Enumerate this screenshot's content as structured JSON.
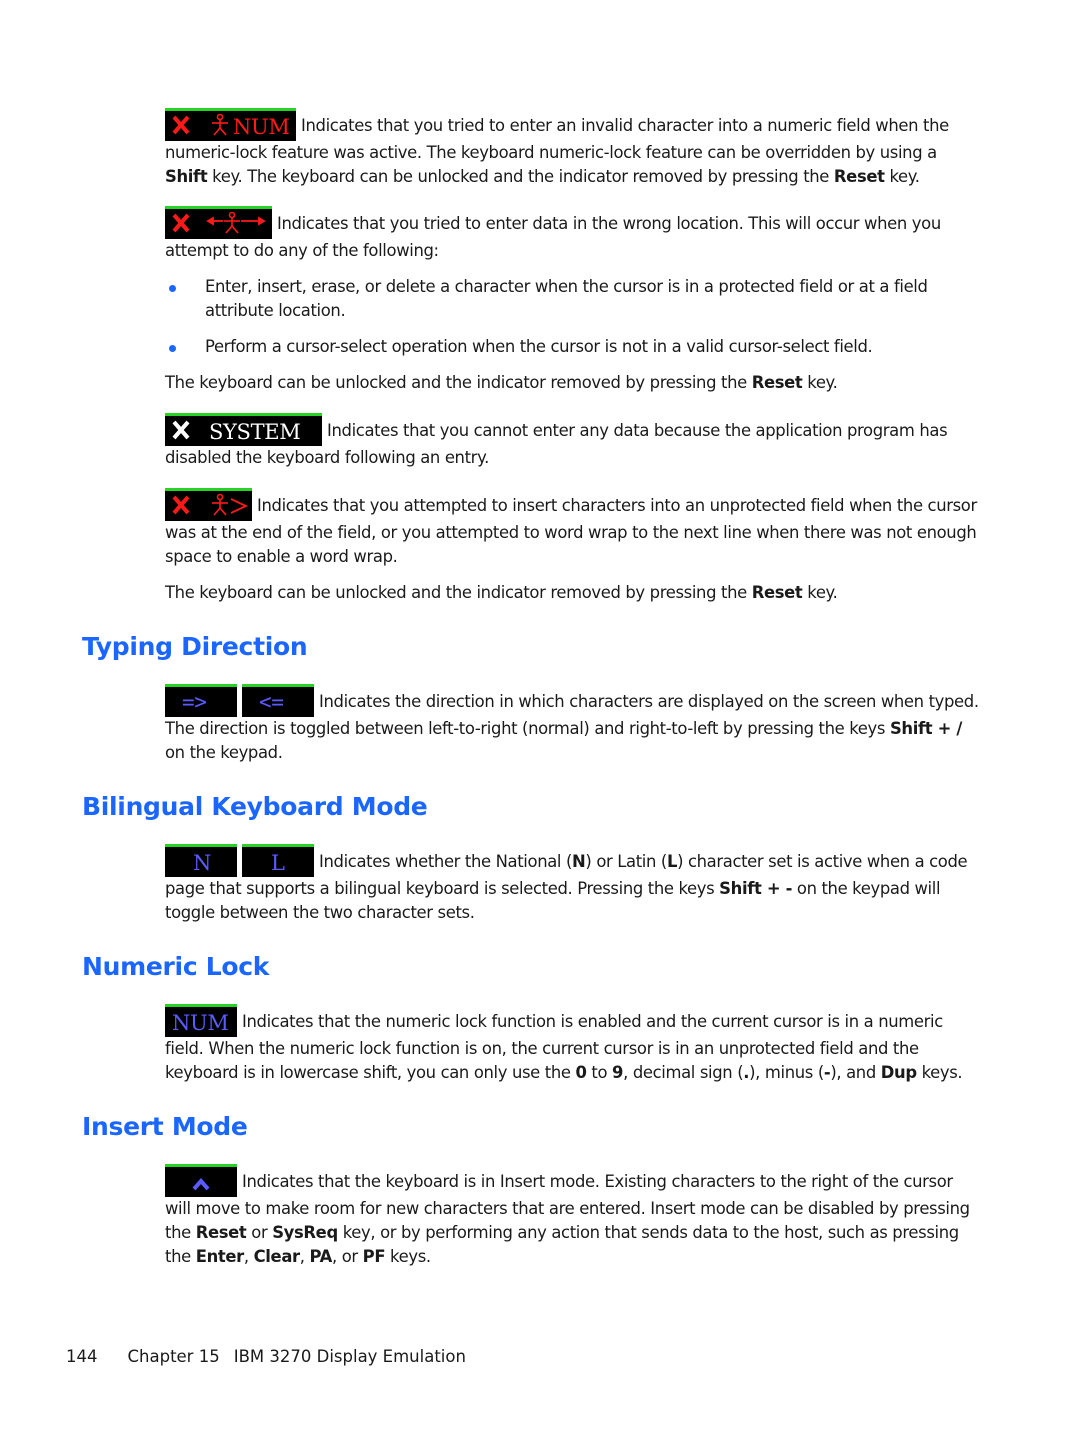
{
  "indicators": {
    "invalid_numeric": {
      "text": "NUM",
      "icons": [
        "x-lock-icon",
        "person-icon"
      ],
      "color": "#ff1a1a"
    },
    "wrong_location": {
      "icons": [
        "x-lock-icon",
        "arrow-left-icon",
        "person-icon",
        "arrow-right-icon"
      ],
      "color": "#ff1a1a"
    },
    "system": {
      "text": "SYSTEM",
      "icons": [
        "x-lock-icon"
      ],
      "color": "#ffffff"
    },
    "overflow": {
      "icons": [
        "x-lock-icon",
        "person-icon",
        "greater-than-icon"
      ],
      "color": "#ff1a1a"
    },
    "direction_ltr": {
      "text": "=>",
      "color": "#5b5bff"
    },
    "direction_rtl": {
      "text": "<=",
      "color": "#5b5bff"
    },
    "national": {
      "text": "N",
      "color": "#5b5bff"
    },
    "latin": {
      "text": "L",
      "color": "#5b5bff"
    },
    "numeric_lock": {
      "text": "NUM",
      "color": "#5b5bff"
    },
    "insert": {
      "icons": [
        "caret-up-icon"
      ],
      "color": "#5b5bff"
    },
    "border_color": "#27d327"
  },
  "sections": {
    "num_error": {
      "p1_a": "Indicates that you tried to enter an invalid character into a numeric field when the numeric-lock feature was active. The keyboard numeric-lock feature can be overridden by using a ",
      "p1_b": "Shift",
      "p1_c": " key. The keyboard can be unlocked and the indicator removed by pressing the ",
      "p1_d": "Reset",
      "p1_e": " key."
    },
    "location_error": {
      "p1": "Indicates that you tried to enter data in the wrong location. This will occur when you attempt to do any of the following:",
      "bullets": [
        "Enter, insert, erase, or delete a character when the cursor is in a protected field or at a field attribute location.",
        "Perform a cursor-select operation when the cursor is not in a valid cursor-select field."
      ],
      "p2_a": "The keyboard can be unlocked and the indicator removed by pressing the ",
      "p2_b": "Reset",
      "p2_c": " key."
    },
    "system": {
      "p1": "Indicates that you cannot enter any data because the application program has disabled the keyboard following an entry."
    },
    "overflow": {
      "p1": "Indicates that you attempted to insert characters into an unprotected field when the cursor was at the end of the field, or you attempted to word wrap to the next line when there was not enough space to enable a word wrap.",
      "p2_a": "The keyboard can be unlocked and the indicator removed by pressing the ",
      "p2_b": "Reset",
      "p2_c": " key."
    },
    "typing_direction": {
      "heading": "Typing Direction",
      "p1_a": "Indicates the direction in which characters are displayed on the screen when typed. The direction is toggled between left-to-right (normal) and right-to-left by pressing the keys ",
      "p1_b": "Shift + /",
      "p1_c": " on the keypad."
    },
    "bilingual": {
      "heading": "Bilingual Keyboard Mode",
      "p1_a": "Indicates whether the National (",
      "p1_b": "N",
      "p1_c": ") or Latin (",
      "p1_d": "L",
      "p1_e": ") character set is active when a code page that supports a bilingual keyboard is selected. Pressing the keys ",
      "p1_f": "Shift + -",
      "p1_g": " on the keypad will toggle between the two character sets."
    },
    "numeric_lock": {
      "heading": "Numeric Lock",
      "p1_a": "Indicates that the numeric lock function is enabled and the current cursor is in a numeric field. When the numeric lock function is on, the current cursor is in an unprotected field and the keyboard is in lowercase shift, you can only use the ",
      "p1_b": "0",
      "p1_c": " to ",
      "p1_d": "9",
      "p1_e": ", decimal sign (",
      "p1_f": ".",
      "p1_g": "), minus (",
      "p1_h": "-",
      "p1_i": "), and ",
      "p1_j": "Dup",
      "p1_k": " keys."
    },
    "insert_mode": {
      "heading": "Insert Mode",
      "p1_a": "Indicates that the keyboard is in Insert mode. Existing characters to the right of the cursor will move to make room for new characters that are entered. Insert mode can be disabled by pressing the ",
      "p1_b": "Reset",
      "p1_c": " or ",
      "p1_d": "SysReq",
      "p1_e": " key, or by performing any action that sends data to the host, such as pressing the ",
      "p1_f": "Enter",
      "p1_g": ", ",
      "p1_h": "Clear",
      "p1_i": ", ",
      "p1_j": "PA",
      "p1_k": ", or ",
      "p1_l": "PF",
      "p1_m": " keys."
    }
  },
  "footer": {
    "page_number": "144",
    "chapter": "Chapter 15",
    "chapter_title": "IBM 3270 Display Emulation"
  }
}
